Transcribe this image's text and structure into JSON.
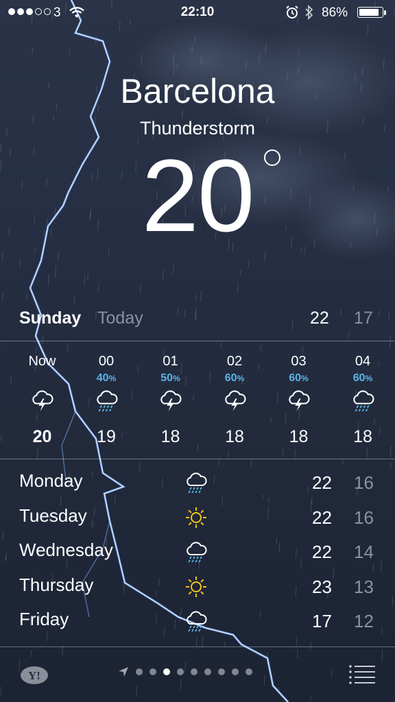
{
  "status": {
    "carrier": "3",
    "time": "22:10",
    "battery": "86%",
    "battery_level": 0.86,
    "signal_bars_on": 3,
    "signal_bars_total": 5,
    "icons": [
      "wifi-icon",
      "alarm-icon",
      "bluetooth-icon",
      "battery-icon"
    ]
  },
  "location": {
    "city": "Barcelona",
    "condition": "Thunderstorm",
    "temperature": "20"
  },
  "today": {
    "day": "Sunday",
    "label": "Today",
    "high": "22",
    "low": "17"
  },
  "hourly": [
    {
      "time": "Now",
      "chance": "",
      "icon": "thunderstorm-icon",
      "temp": "20"
    },
    {
      "time": "00",
      "chance": "40",
      "icon": "rain-icon",
      "temp": "19"
    },
    {
      "time": "01",
      "chance": "50",
      "icon": "thunderstorm-icon",
      "temp": "18"
    },
    {
      "time": "02",
      "chance": "60",
      "icon": "thunderstorm-icon",
      "temp": "18"
    },
    {
      "time": "03",
      "chance": "60",
      "icon": "thunderstorm-icon",
      "temp": "18"
    },
    {
      "time": "04",
      "chance": "60",
      "icon": "rain-icon",
      "temp": "18"
    }
  ],
  "percent_sign": "%",
  "daily": [
    {
      "day": "Monday",
      "icon": "rain-icon",
      "high": "22",
      "low": "16"
    },
    {
      "day": "Tuesday",
      "icon": "sun-icon",
      "high": "22",
      "low": "16"
    },
    {
      "day": "Wednesday",
      "icon": "rain-icon",
      "high": "22",
      "low": "14"
    },
    {
      "day": "Thursday",
      "icon": "sun-icon",
      "high": "23",
      "low": "13"
    },
    {
      "day": "Friday",
      "icon": "rain-icon",
      "high": "17",
      "low": "12"
    }
  ],
  "bottom": {
    "logo_text": "Y!",
    "page_count": 9,
    "active_page": 2
  },
  "colors": {
    "background": "#252e42",
    "precip_blue": "#5ab4e8",
    "sun_yellow": "#f5c518",
    "rain_blue": "#5ab4e8",
    "muted_text": "#8a93a6"
  }
}
